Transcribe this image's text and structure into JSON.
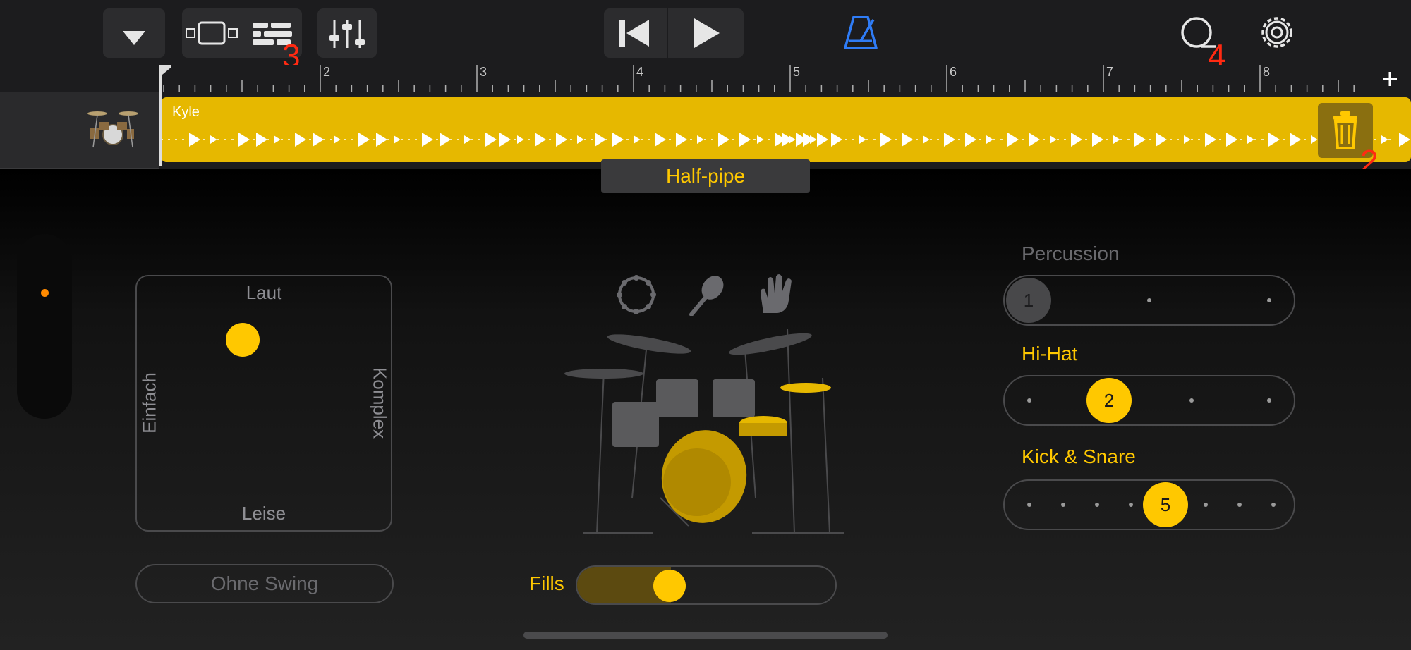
{
  "toolbar": {
    "view_annotation": "3",
    "loop_annotation": "4",
    "accent": "#2f7cf6"
  },
  "ruler": {
    "bars": [
      "2",
      "3",
      "4",
      "5",
      "6",
      "7",
      "8"
    ]
  },
  "track": {
    "region_name": "Kyle",
    "delete_annotation": "2",
    "region_color": "#e6b800"
  },
  "preset": {
    "name": "Half-pipe"
  },
  "xy_pad": {
    "top_label": "Laut",
    "bottom_label": "Leise",
    "left_label": "Einfach",
    "right_label": "Komplex"
  },
  "swing": {
    "label": "Ohne Swing"
  },
  "fills": {
    "label": "Fills",
    "level": 0.36
  },
  "sliders": [
    {
      "label": "Percussion",
      "value": "1",
      "active": false
    },
    {
      "label": "Hi-Hat",
      "value": "2",
      "active": true
    },
    {
      "label": "Kick & Snare",
      "value": "5",
      "active": true
    }
  ],
  "colors": {
    "accent": "#ffc800",
    "background": "#1c1c1e"
  }
}
